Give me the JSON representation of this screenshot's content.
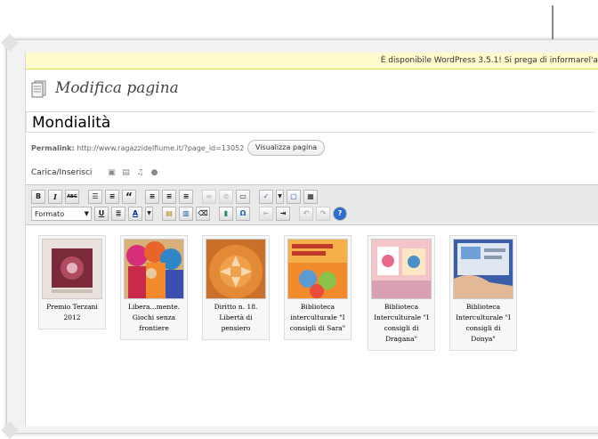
{
  "notice": {
    "text": "È disponibile WordPress 3.5.1! Si prega di informarel'a"
  },
  "header": {
    "title": "Modifica pagina"
  },
  "post": {
    "title": "Mondialità"
  },
  "permalink": {
    "label": "Permalink:",
    "url": "http://www.ragazzidelfiume.it/?page_id=13052",
    "view_button": "Visualizza pagina"
  },
  "media": {
    "label": "Carica/Inserisci"
  },
  "toolbar": {
    "bold": "B",
    "italic": "I",
    "strike": "ABC",
    "quote": "“",
    "format_value": "Formato",
    "underline": "U",
    "textcolor": "A",
    "omega": "Ω"
  },
  "gallery": [
    {
      "caption": "Premio Terzani 2012"
    },
    {
      "caption": "Libera...mente. Giochi senza frontiere"
    },
    {
      "caption": "Diritto n. 18. Libertà di pensiero"
    },
    {
      "caption": "Biblioteca interculturale \"I consigli di Sara\""
    },
    {
      "caption": "Biblioteca Interculturale \"I consigli di Dragana\""
    },
    {
      "caption": "Biblioteca Interculturale \"I consigli di Donya\""
    }
  ],
  "colors": {
    "notice_bg": "#fffbcc",
    "toolbar_bg": "#e9e9e9"
  }
}
